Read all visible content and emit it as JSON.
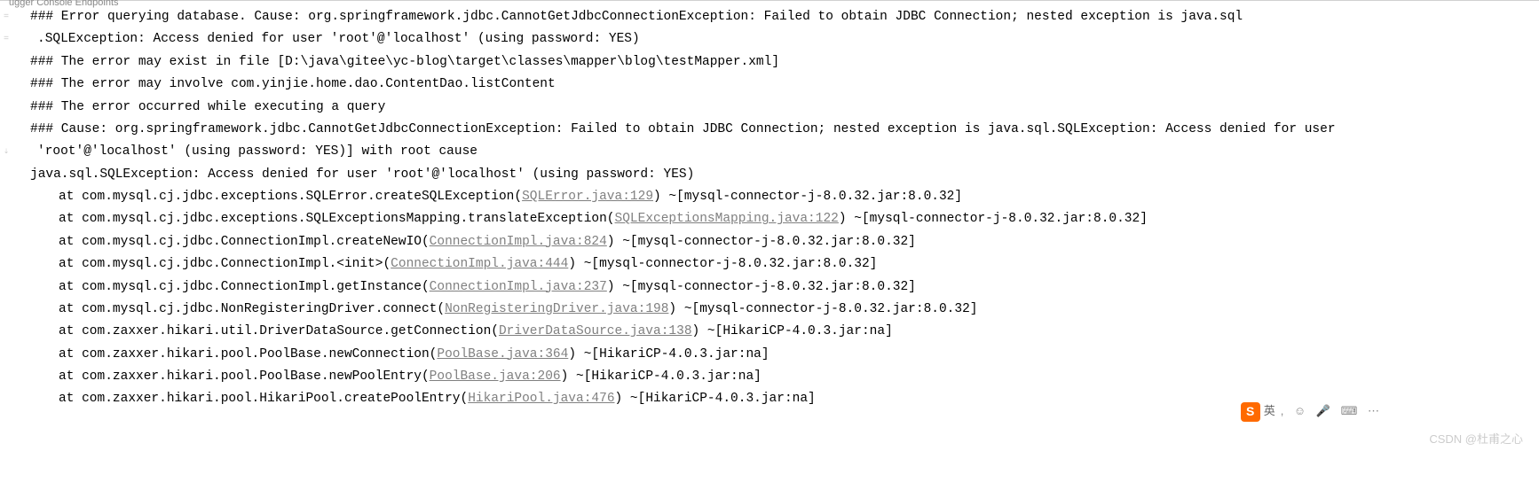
{
  "tabs_fragment": "ugger      Console       Endpoints",
  "gutter": [
    "=",
    "=",
    "",
    "",
    "",
    "",
    "⇣",
    "",
    "",
    "",
    "",
    "",
    "",
    "",
    "",
    "",
    "",
    "",
    ""
  ],
  "lines": [
    {
      "cls": "console-line",
      "text": "### Error querying database.  Cause: org.springframework.jdbc.CannotGetJdbcConnectionException: Failed to obtain JDBC Connection; nested exception is java.sql"
    },
    {
      "cls": "console-line wrapped",
      "text": ".SQLException: Access denied for user 'root'@'localhost' (using password: YES)"
    },
    {
      "cls": "console-line",
      "text": "### The error may exist in file [D:\\java\\gitee\\yc-blog\\target\\classes\\mapper\\blog\\testMapper.xml]"
    },
    {
      "cls": "console-line",
      "text": "### The error may involve com.yinjie.home.dao.ContentDao.listContent"
    },
    {
      "cls": "console-line",
      "text": "### The error occurred while executing a query"
    },
    {
      "cls": "console-line",
      "text": "### Cause: org.springframework.jdbc.CannotGetJdbcConnectionException: Failed to obtain JDBC Connection; nested exception is java.sql.SQLException: Access denied for user"
    },
    {
      "cls": "console-line wrapped",
      "text": "'root'@'localhost' (using password: YES)] with root cause"
    },
    {
      "cls": "console-line",
      "text": " "
    },
    {
      "cls": "console-line",
      "text": "java.sql.SQLException: Access denied for user 'root'@'localhost' (using password: YES)"
    },
    {
      "cls": "console-line stack",
      "pre": "at com.mysql.cj.jdbc.exceptions.SQLError.createSQLException(",
      "link": "SQLError.java:129",
      "post": ") ~[mysql-connector-j-8.0.32.jar:8.0.32]"
    },
    {
      "cls": "console-line stack",
      "pre": "at com.mysql.cj.jdbc.exceptions.SQLExceptionsMapping.translateException(",
      "link": "SQLExceptionsMapping.java:122",
      "post": ") ~[mysql-connector-j-8.0.32.jar:8.0.32]"
    },
    {
      "cls": "console-line stack",
      "pre": "at com.mysql.cj.jdbc.ConnectionImpl.createNewIO(",
      "link": "ConnectionImpl.java:824",
      "post": ") ~[mysql-connector-j-8.0.32.jar:8.0.32]"
    },
    {
      "cls": "console-line stack",
      "pre": "at com.mysql.cj.jdbc.ConnectionImpl.<init>(",
      "link": "ConnectionImpl.java:444",
      "post": ") ~[mysql-connector-j-8.0.32.jar:8.0.32]"
    },
    {
      "cls": "console-line stack",
      "pre": "at com.mysql.cj.jdbc.ConnectionImpl.getInstance(",
      "link": "ConnectionImpl.java:237",
      "post": ") ~[mysql-connector-j-8.0.32.jar:8.0.32]"
    },
    {
      "cls": "console-line stack",
      "pre": "at com.mysql.cj.jdbc.NonRegisteringDriver.connect(",
      "link": "NonRegisteringDriver.java:198",
      "post": ") ~[mysql-connector-j-8.0.32.jar:8.0.32]"
    },
    {
      "cls": "console-line stack",
      "pre": "at com.zaxxer.hikari.util.DriverDataSource.getConnection(",
      "link": "DriverDataSource.java:138",
      "post": ") ~[HikariCP-4.0.3.jar:na]"
    },
    {
      "cls": "console-line stack",
      "pre": "at com.zaxxer.hikari.pool.PoolBase.newConnection(",
      "link": "PoolBase.java:364",
      "post": ") ~[HikariCP-4.0.3.jar:na]"
    },
    {
      "cls": "console-line stack",
      "pre": "at com.zaxxer.hikari.pool.PoolBase.newPoolEntry(",
      "link": "PoolBase.java:206",
      "post": ") ~[HikariCP-4.0.3.jar:na]"
    },
    {
      "cls": "console-line stack",
      "pre": "at com.zaxxer.hikari.pool.HikariPool.createPoolEntry(",
      "link": "HikariPool.java:476",
      "post": ") ~[HikariCP-4.0.3.jar:na]"
    }
  ],
  "ime": {
    "logo_letter": "S",
    "lang": "英",
    "icons": ", ☺ 🎤 ⌨ ⋯"
  },
  "watermark": "CSDN @杜甫之心"
}
